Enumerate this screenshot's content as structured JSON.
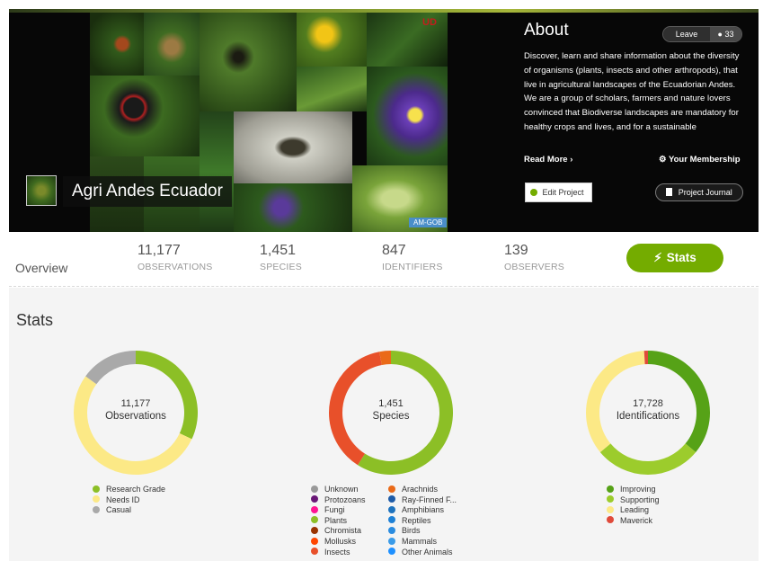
{
  "banner": {
    "project_name": "Agri Andes Ecuador",
    "collage_badge": "AM-GOB",
    "collage_corner_mark": "UD",
    "about_title": "About",
    "leave_label": "Leave",
    "member_count": "33",
    "description": "Discover, learn and share information about the diversity of organisms (plants, insects and other arthropods), that live in agricultural landscapes of the Ecuadorian Andes. We are a group of scholars, farmers and nature lovers convinced that Biodiverse landscapes are mandatory for healthy crops and lives, and for a sustainable",
    "read_more": "Read More ›",
    "your_membership": "Your Membership",
    "edit_project": "Edit Project",
    "project_journal": "Project Journal"
  },
  "overview": {
    "label": "Overview",
    "stats": [
      {
        "value": "11,177",
        "label": "OBSERVATIONS"
      },
      {
        "value": "1,451",
        "label": "SPECIES"
      },
      {
        "value": "847",
        "label": "IDENTIFIERS"
      },
      {
        "value": "139",
        "label": "OBSERVERS"
      }
    ],
    "stats_button": "Stats"
  },
  "stats": {
    "heading": "Stats",
    "observations": {
      "value": "11,177",
      "label": "Observations"
    },
    "species": {
      "value": "1,451",
      "label": "Species"
    },
    "identifications": {
      "value": "17,728",
      "label": "Identifications"
    }
  },
  "chart_data": [
    {
      "type": "pie",
      "title": "Observations",
      "categories": [
        "Research Grade",
        "Needs ID",
        "Casual"
      ],
      "values": [
        32,
        53,
        15
      ],
      "colors": [
        "#8cbf26",
        "#fce986",
        "#a9a9a9"
      ]
    },
    {
      "type": "pie",
      "title": "Species",
      "categories": [
        "Unknown",
        "Protozoans",
        "Fungi",
        "Plants",
        "Chromista",
        "Mollusks",
        "Insects",
        "Arachnids",
        "Ray-Finned F...",
        "Amphibians",
        "Reptiles",
        "Birds",
        "Mammals",
        "Other Animals"
      ],
      "values": [
        0,
        0,
        0,
        59,
        0,
        0,
        38,
        3,
        0,
        0,
        0,
        0,
        0,
        0
      ],
      "colors": [
        "#999999",
        "#691776",
        "#ff1493",
        "#8cbf26",
        "#993300",
        "#ff4500",
        "#e8502a",
        "#ea6a18",
        "#1e5ca8",
        "#1e73be",
        "#1e81d6",
        "#2a8ce0",
        "#3a9be8",
        "#1e90ff"
      ]
    },
    {
      "type": "pie",
      "title": "Identifications",
      "categories": [
        "Improving",
        "Supporting",
        "Leading",
        "Maverick"
      ],
      "values": [
        36,
        28,
        35,
        1
      ],
      "colors": [
        "#56a217",
        "#9ccc2c",
        "#fce986",
        "#e04a3a"
      ]
    }
  ],
  "legends": {
    "observations": [
      {
        "label": "Research Grade",
        "color": "#8cbf26"
      },
      {
        "label": "Needs ID",
        "color": "#fce986"
      },
      {
        "label": "Casual",
        "color": "#a9a9a9"
      }
    ],
    "species_a": [
      {
        "label": "Unknown",
        "color": "#999999"
      },
      {
        "label": "Protozoans",
        "color": "#691776"
      },
      {
        "label": "Fungi",
        "color": "#ff1493"
      },
      {
        "label": "Plants",
        "color": "#8cbf26"
      },
      {
        "label": "Chromista",
        "color": "#993300"
      },
      {
        "label": "Mollusks",
        "color": "#ff4500"
      },
      {
        "label": "Insects",
        "color": "#e8502a"
      }
    ],
    "species_b": [
      {
        "label": "Arachnids",
        "color": "#ea6a18"
      },
      {
        "label": "Ray-Finned F...",
        "color": "#1e5ca8"
      },
      {
        "label": "Amphibians",
        "color": "#1e73be"
      },
      {
        "label": "Reptiles",
        "color": "#1e81d6"
      },
      {
        "label": "Birds",
        "color": "#2a8ce0"
      },
      {
        "label": "Mammals",
        "color": "#3a9be8"
      },
      {
        "label": "Other Animals",
        "color": "#1e90ff"
      }
    ],
    "identifications": [
      {
        "label": "Improving",
        "color": "#56a217"
      },
      {
        "label": "Supporting",
        "color": "#9ccc2c"
      },
      {
        "label": "Leading",
        "color": "#fce986"
      },
      {
        "label": "Maverick",
        "color": "#e04a3a"
      }
    ]
  },
  "icons": {
    "user": "user-icon",
    "gear": "gear-icon",
    "edit": "plus-circle-icon",
    "journal": "book-icon",
    "bolt": "lightning-icon"
  },
  "colors": {
    "accent": "#74ac00",
    "banner_bg": "#070707",
    "stats_bg": "#f4f4f4"
  }
}
